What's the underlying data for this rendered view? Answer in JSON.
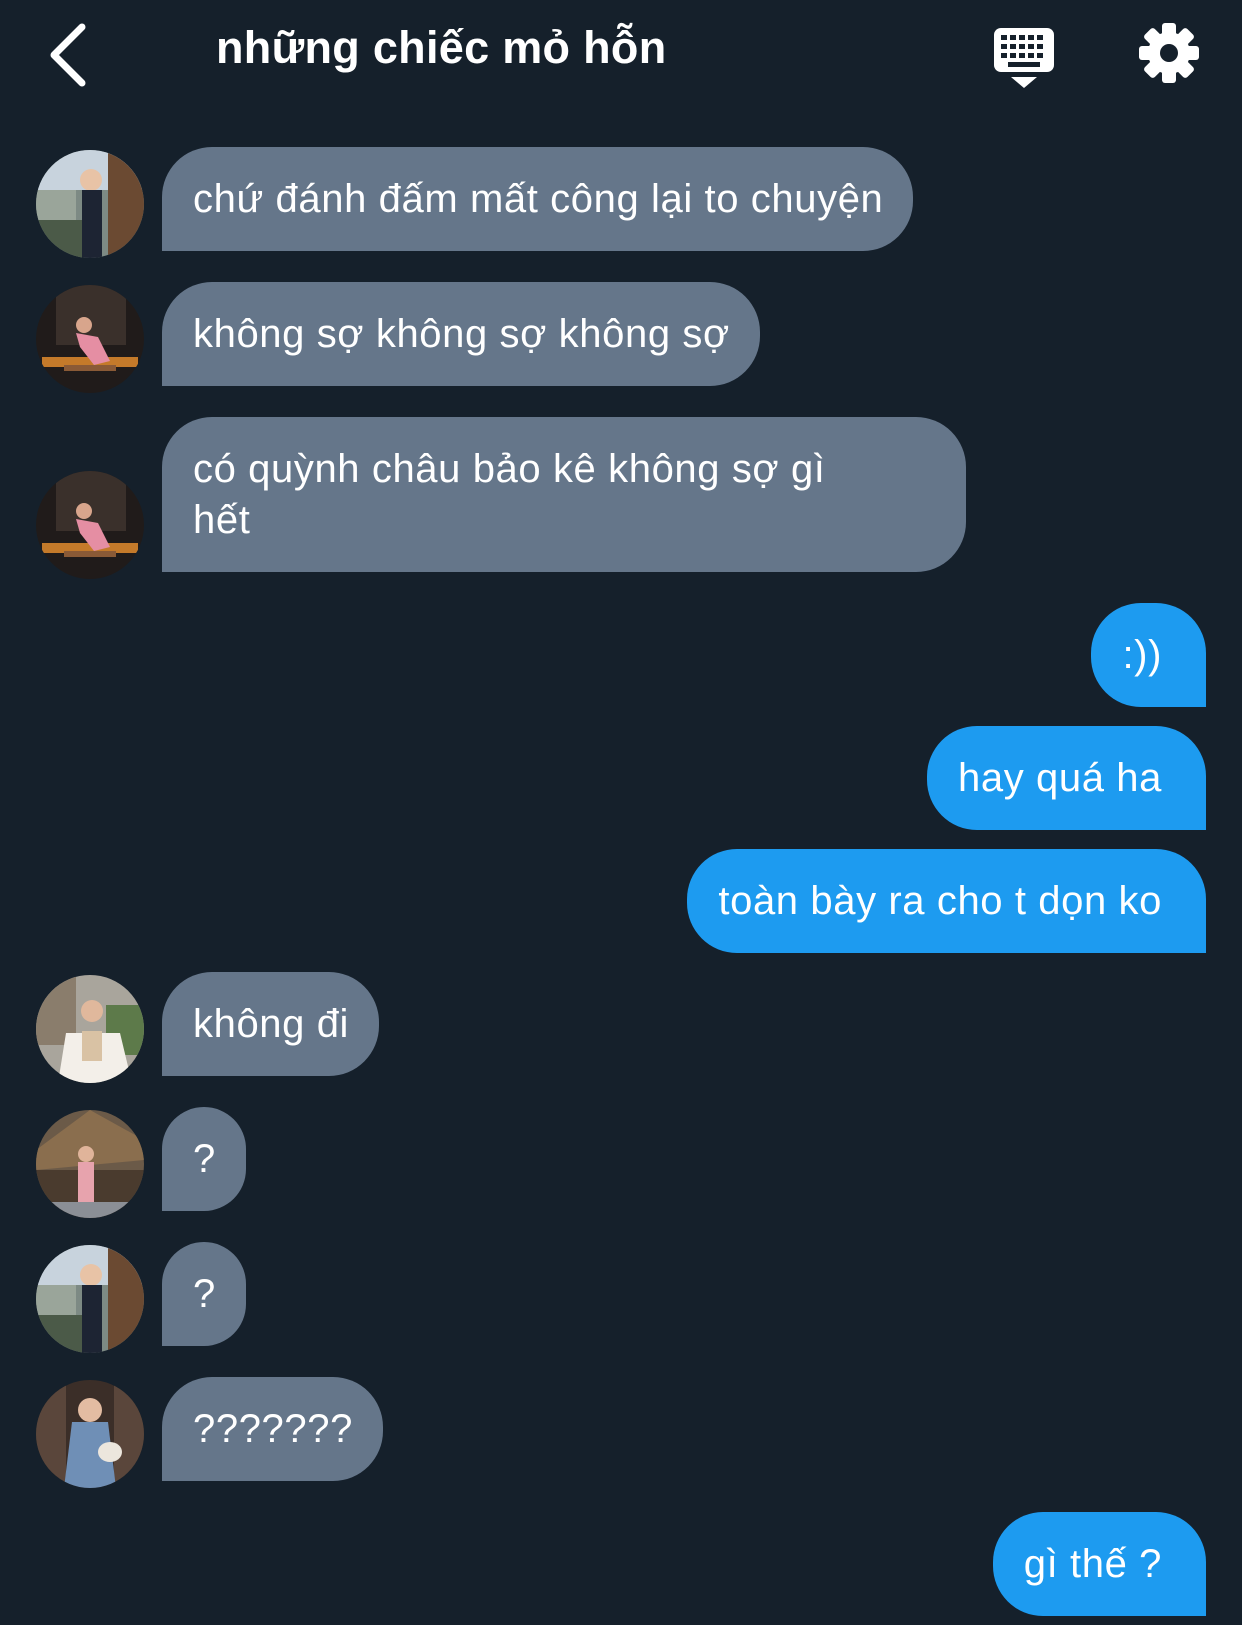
{
  "header": {
    "title": "những chiếc mỏ hỗn",
    "back_icon": "chevron-left-icon",
    "keyboard_icon": "keyboard-icon",
    "settings_icon": "gear-icon"
  },
  "colors": {
    "background": "#15202b",
    "incoming_bubble": "#65768a",
    "outgoing_bubble": "#1d9bf0",
    "text": "#ffffff"
  },
  "messages": [
    {
      "direction": "in",
      "text": "chứ đánh đấm mất công lại to chuyện"
    },
    {
      "direction": "in",
      "text": "không sợ không sợ không sợ"
    },
    {
      "direction": "in",
      "text": "có quỳnh châu bảo kê không sợ gì hết"
    },
    {
      "direction": "out",
      "text": ":))"
    },
    {
      "direction": "out",
      "text": "hay quá ha"
    },
    {
      "direction": "out",
      "text": "toàn bày ra cho t dọn ko"
    },
    {
      "direction": "in",
      "text": "không đi"
    },
    {
      "direction": "in",
      "text": "?"
    },
    {
      "direction": "in",
      "text": "?"
    },
    {
      "direction": "in",
      "text": "???????"
    },
    {
      "direction": "out",
      "text": "gì thế ?"
    }
  ]
}
